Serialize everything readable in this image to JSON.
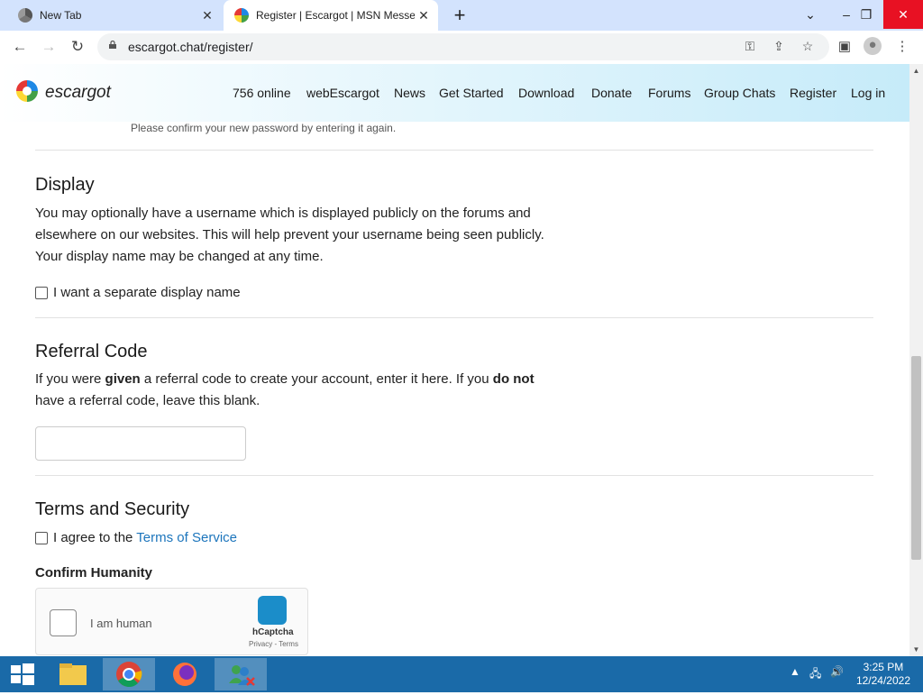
{
  "browser": {
    "tabs": [
      {
        "title": "New Tab"
      },
      {
        "title": "Register | Escargot | MSN Messenger"
      }
    ],
    "url": "escargot.chat/register/"
  },
  "site": {
    "brand": "escargot",
    "nav": [
      "756 online",
      "webEscargot",
      "News",
      "Get Started",
      "Download",
      "Donate",
      "Forums",
      "Group Chats",
      "Register",
      "Log in"
    ]
  },
  "form": {
    "password_hint": "Please confirm your new password by entering it again.",
    "display": {
      "heading": "Display",
      "lines": [
        "You may optionally have a username which is displayed publicly on the forums and",
        "elsewhere on our websites. This will help prevent your username being seen publicly.",
        "Your display name may be changed at any time."
      ],
      "checkbox_label": "I want a separate display name"
    },
    "referral": {
      "heading": "Referral Code",
      "line1_a": "If you were ",
      "line1_b": "given",
      "line1_c": " a referral code to create your account, enter it here. If you ",
      "line1_d": "do not",
      "line2": "have a referral code, leave this blank.",
      "input_value": ""
    },
    "terms": {
      "heading": "Terms and Security",
      "agree_prefix": "I agree to the ",
      "agree_link": "Terms of Service",
      "humanity_heading": "Confirm Humanity",
      "captcha_label": "I am human",
      "captcha_brand": "hCaptcha",
      "captcha_links": "Privacy - Terms"
    }
  },
  "taskbar": {
    "time": "3:25 PM",
    "date": "12/24/2022"
  }
}
